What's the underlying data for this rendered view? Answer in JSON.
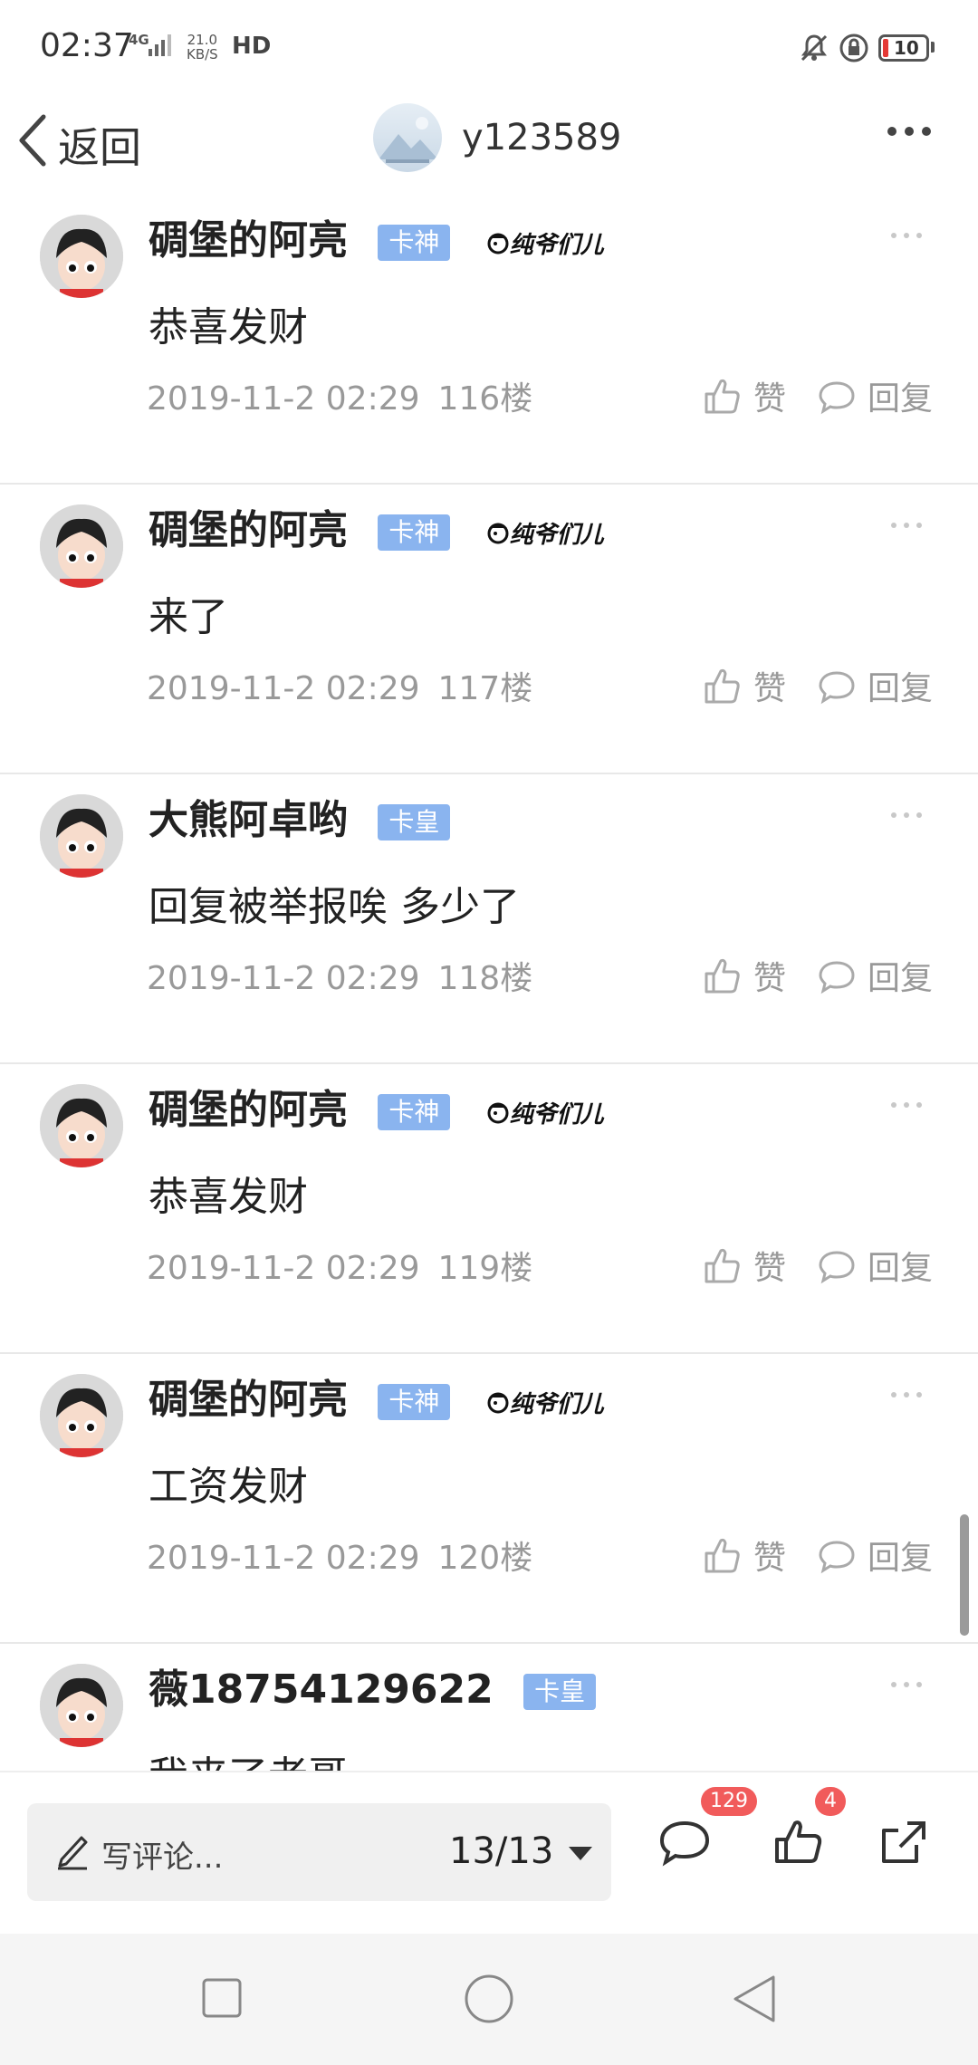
{
  "status_bar": {
    "time": "02:37",
    "network": "4G",
    "speed_value": "21.0",
    "speed_unit": "KB/S",
    "hd": "HD",
    "battery": "10",
    "battery_color": "#e53935"
  },
  "nav": {
    "back_label": "返回",
    "title": "y123589"
  },
  "comments": [
    {
      "user": "碉堡的阿亮",
      "badge": "卡神",
      "medal": "纯爷们儿",
      "text": "恭喜发财",
      "time": "2019-11-2 02:29",
      "floor": "116楼",
      "like": "赞",
      "reply": "回复"
    },
    {
      "user": "碉堡的阿亮",
      "badge": "卡神",
      "medal": "纯爷们儿",
      "text": "来了",
      "time": "2019-11-2 02:29",
      "floor": "117楼",
      "like": "赞",
      "reply": "回复"
    },
    {
      "user": "大熊阿卓哟",
      "badge": "卡皇",
      "medal": "",
      "text": "回复被举报唉 多少了",
      "time": "2019-11-2 02:29",
      "floor": "118楼",
      "like": "赞",
      "reply": "回复"
    },
    {
      "user": "碉堡的阿亮",
      "badge": "卡神",
      "medal": "纯爷们儿",
      "text": "恭喜发财",
      "time": "2019-11-2 02:29",
      "floor": "119楼",
      "like": "赞",
      "reply": "回复"
    },
    {
      "user": "碉堡的阿亮",
      "badge": "卡神",
      "medal": "纯爷们儿",
      "text": "工资发财",
      "time": "2019-11-2 02:29",
      "floor": "120楼",
      "like": "赞",
      "reply": "回复"
    },
    {
      "user": "薇18754129622",
      "badge": "卡皇",
      "medal": "",
      "text": "我来了老哥",
      "time": "",
      "floor": "",
      "like": "",
      "reply": ""
    }
  ],
  "bottom": {
    "placeholder": "写评论...",
    "page": "13/13",
    "comment_count": "129",
    "like_count": "4"
  },
  "colors": {
    "badge_blue": "#8ab4ef",
    "count_red": "#f15b5b"
  },
  "icons": [
    "bell-off-icon",
    "rotation-lock-icon",
    "chevron-left-icon",
    "more-icon",
    "thumbs-up-icon",
    "comment-bubble-icon",
    "pencil-icon",
    "share-icon",
    "square-icon",
    "circle-icon",
    "triangle-back-icon"
  ]
}
